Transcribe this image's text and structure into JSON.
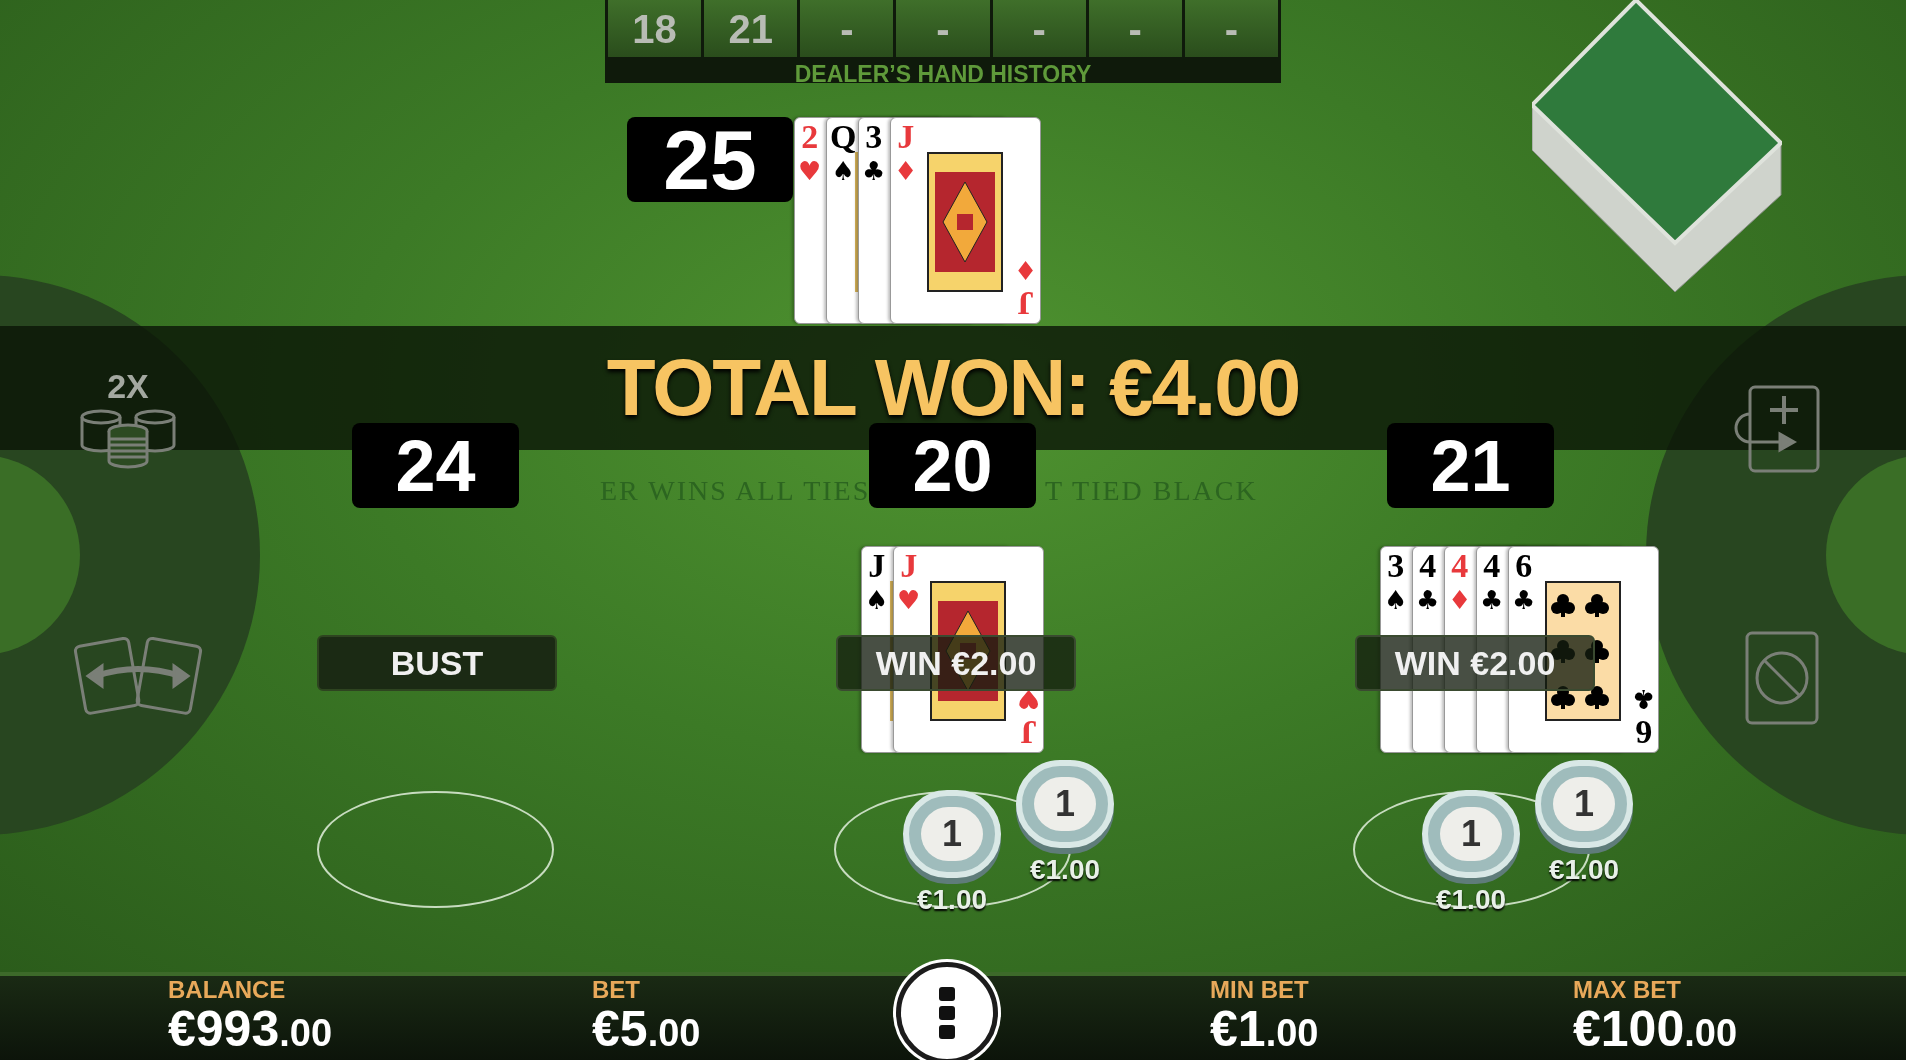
{
  "dealer_history": {
    "label": "DEALER’S HAND HISTORY",
    "scores": [
      "18",
      "21",
      "-",
      "-",
      "-",
      "-",
      "-"
    ]
  },
  "dealer": {
    "score": "25",
    "cards": [
      {
        "rank": "2",
        "suit": "♥",
        "color": "#e8393c",
        "kind": "number"
      },
      {
        "rank": "Q",
        "suit": "♠",
        "color": "#000000",
        "kind": "face"
      },
      {
        "rank": "3",
        "suit": "♣",
        "color": "#000000",
        "kind": "number"
      },
      {
        "rank": "J",
        "suit": "♦",
        "color": "#e8393c",
        "kind": "face",
        "bottom_rank": "J",
        "bottom_suit": "♦"
      }
    ]
  },
  "banner": {
    "text": "TOTAL WON: €4.00"
  },
  "felt_texts": [
    "ER WINS ALL TIES",
    "T TIED BLACK"
  ],
  "hands": [
    {
      "score": "24",
      "result": "BUST",
      "kind": "bust"
    },
    {
      "score": "20",
      "result": "WIN €2.00",
      "kind": "win",
      "cards": [
        {
          "rank": "J",
          "suit": "♠",
          "color": "#000000",
          "kind": "face"
        },
        {
          "rank": "J",
          "suit": "♥",
          "color": "#e8393c",
          "kind": "face",
          "bottom_rank": "J",
          "bottom_suit": "♥"
        }
      ],
      "chips": [
        {
          "value": "1",
          "amount": "€1.00"
        },
        {
          "value": "1",
          "amount": "€1.00"
        }
      ]
    },
    {
      "score": "21",
      "result": "WIN €2.00",
      "kind": "win",
      "cards": [
        {
          "rank": "3",
          "suit": "♠",
          "color": "#000000",
          "kind": "number"
        },
        {
          "rank": "4",
          "suit": "♣",
          "color": "#000000",
          "kind": "number"
        },
        {
          "rank": "4",
          "suit": "♦",
          "color": "#e8393c",
          "kind": "number"
        },
        {
          "rank": "4",
          "suit": "♣",
          "color": "#000000",
          "kind": "number"
        },
        {
          "rank": "6",
          "suit": "♣",
          "color": "#000000",
          "kind": "number",
          "bottom_rank": "6",
          "bottom_suit": "♣"
        }
      ],
      "chips": [
        {
          "value": "1",
          "amount": "€1.00"
        },
        {
          "value": "1",
          "amount": "€1.00"
        }
      ]
    }
  ],
  "left_controls": [
    {
      "kind": "double",
      "label": "2X"
    },
    {
      "kind": "split"
    }
  ],
  "right_controls": [
    {
      "kind": "hit"
    },
    {
      "kind": "stand"
    }
  ],
  "stats": [
    {
      "label": "BALANCE",
      "value": "€993.00"
    },
    {
      "label": "BET",
      "value": "€5.00"
    },
    {
      "label": "MIN BET",
      "value": "€1.00"
    },
    {
      "label": "MAX BET",
      "value": "€100.00"
    }
  ]
}
